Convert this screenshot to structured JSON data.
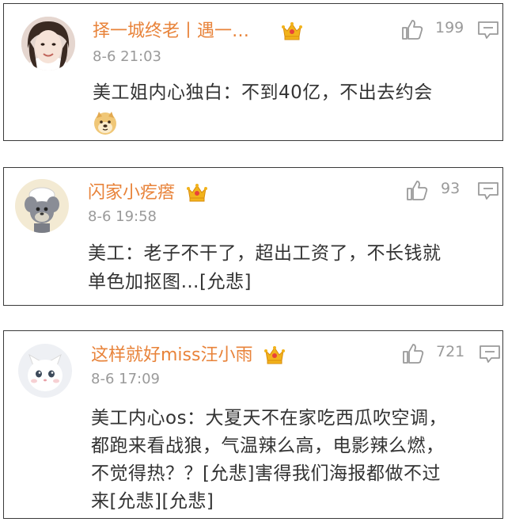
{
  "comments": [
    {
      "username": "择一城终老丨遇一…",
      "time": "8-6 21:03",
      "likes": "199",
      "text": "美工姐内心独白：不到40亿，不出去约会",
      "emoji": "doge-emoji"
    },
    {
      "username": "闪家小疙瘩",
      "time": "8-6 19:58",
      "likes": "93",
      "text_line1": "美工：老子不干了，超出工资了，不长钱就",
      "text_line2": "单色加抠图…[允悲]"
    },
    {
      "username": "这样就好miss汪小雨",
      "time": "8-6 17:09",
      "likes": "721",
      "text_line1": "美工内心os：大夏天不在家吃西瓜吹空调，",
      "text_line2": "都跑来看战狼，气温辣么高，电影辣么燃，",
      "text_line3": "不觉得热？？[允悲]害得我们海报都做不过",
      "text_line4": "来[允悲][允悲]"
    }
  ],
  "colors": {
    "username": "#e8833a",
    "meta": "#9a9a9a",
    "text": "#333333",
    "border": "#3a3a3a"
  }
}
